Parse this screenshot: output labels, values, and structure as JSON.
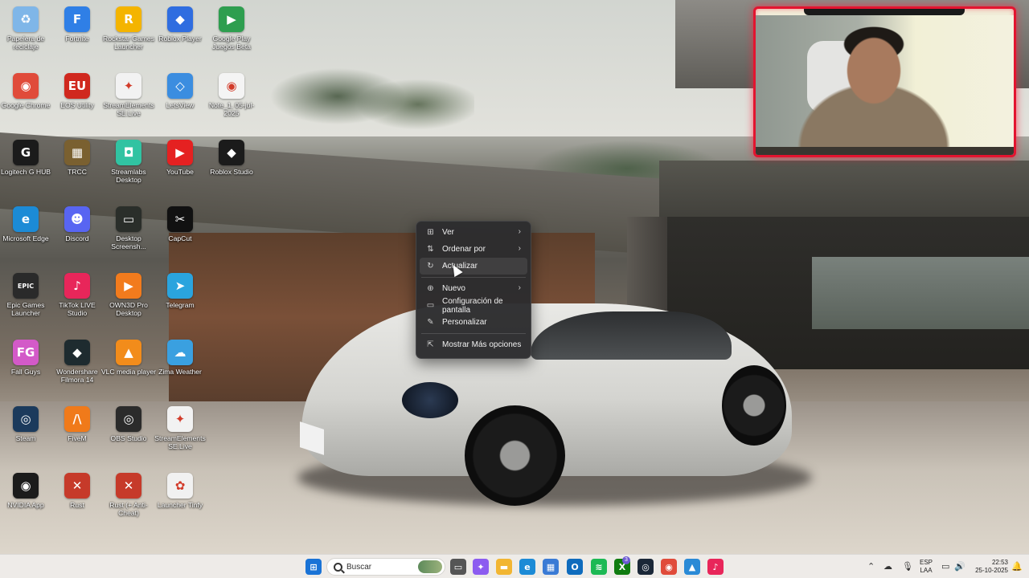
{
  "desktop": {
    "icons": [
      {
        "label": "Papelera de reciclaje",
        "icon": "recycle-bin-icon",
        "color": "#7fb6e8",
        "glyph": "♻"
      },
      {
        "label": "Fortnite",
        "icon": "fortnite-icon",
        "color": "#2f7fe6",
        "glyph": "F"
      },
      {
        "label": "Rockstar Games Launcher",
        "icon": "rockstar-icon",
        "color": "#f4b400",
        "glyph": "R"
      },
      {
        "label": "Roblox Player",
        "icon": "roblox-icon",
        "color": "#2f6de0",
        "glyph": "◆"
      },
      {
        "label": "Google Play Juegos Beta",
        "icon": "google-play-games-icon",
        "color": "#2e9e4f",
        "glyph": "▶"
      },
      {
        "label": "Google Chrome",
        "icon": "chrome-icon",
        "color": "#e04b3a",
        "glyph": "◉"
      },
      {
        "label": "EOS Utility",
        "icon": "eos-utility-icon",
        "color": "#d0281e",
        "glyph": "EU"
      },
      {
        "label": "StreamElements SE.Live",
        "icon": "streamelements-icon",
        "color": "#f2f2f2",
        "glyph": "✦"
      },
      {
        "label": "LetsView",
        "icon": "letsview-icon",
        "color": "#3b8de0",
        "glyph": "◇"
      },
      {
        "label": "Note_1, 05-jul-2025",
        "icon": "chrome-file-icon",
        "color": "#f4f4f4",
        "glyph": "◉"
      },
      {
        "label": "Logitech G HUB",
        "icon": "logitech-icon",
        "color": "#1b1b1b",
        "glyph": "G"
      },
      {
        "label": "TRCC",
        "icon": "trcc-icon",
        "color": "#7a6030",
        "glyph": "▦"
      },
      {
        "label": "Streamlabs Desktop",
        "icon": "streamlabs-icon",
        "color": "#31c3a2",
        "glyph": "◘"
      },
      {
        "label": "YouTube",
        "icon": "youtube-icon",
        "color": "#e52121",
        "glyph": "▶"
      },
      {
        "label": "Roblox Studio",
        "icon": "roblox-studio-icon",
        "color": "#1b1b1b",
        "glyph": "◆"
      },
      {
        "label": "Microsoft Edge",
        "icon": "edge-icon",
        "color": "#1c8bd6",
        "glyph": "e"
      },
      {
        "label": "Discord",
        "icon": "discord-icon",
        "color": "#5865f2",
        "glyph": "☻"
      },
      {
        "label": "Desktop Screensh...",
        "icon": "screenshot-file-icon",
        "color": "#2a2e2a",
        "glyph": "▭"
      },
      {
        "label": "CapCut",
        "icon": "capcut-icon",
        "color": "#111111",
        "glyph": "✂"
      },
      {
        "label": "Epic Games Launcher",
        "icon": "epic-games-icon",
        "color": "#2a2a2a",
        "glyph": "EPIC"
      },
      {
        "label": "TikTok LIVE Studio",
        "icon": "tiktok-live-icon",
        "color": "#e8265a",
        "glyph": "♪"
      },
      {
        "label": "OWN3D Pro Desktop",
        "icon": "own3d-icon",
        "color": "#f27b1d",
        "glyph": "▶"
      },
      {
        "label": "Telegram",
        "icon": "telegram-icon",
        "color": "#2aa4de",
        "glyph": "➤"
      },
      {
        "label": "Fall Guys",
        "icon": "fall-guys-icon",
        "color": "#d35ac8",
        "glyph": "FG"
      },
      {
        "label": "Wondershare Filmora 14",
        "icon": "filmora-icon",
        "color": "#1e2b2f",
        "glyph": "◆"
      },
      {
        "label": "VLC media player",
        "icon": "vlc-icon",
        "color": "#f28c1b",
        "glyph": "▲"
      },
      {
        "label": "Zima Weather",
        "icon": "zima-weather-icon",
        "color": "#3aa0e0",
        "glyph": "☁"
      },
      {
        "label": "Steam",
        "icon": "steam-icon",
        "color": "#1b3a5c",
        "glyph": "◎"
      },
      {
        "label": "FiveM",
        "icon": "fivem-icon",
        "color": "#f07a1a",
        "glyph": "/\\"
      },
      {
        "label": "OBS Studio",
        "icon": "obs-icon",
        "color": "#2b2b2b",
        "glyph": "◎"
      },
      {
        "label": "StreamElements SE.Live",
        "icon": "streamelements-live-icon",
        "color": "#f2f2f2",
        "glyph": "✦"
      },
      {
        "label": "NVIDIA App",
        "icon": "nvidia-icon",
        "color": "#1b1b1b",
        "glyph": "◉"
      },
      {
        "label": "Rust",
        "icon": "rust-icon",
        "color": "#c63a2a",
        "glyph": "✕"
      },
      {
        "label": "Rust (+ Anti-Cheat)",
        "icon": "rust-anticheat-icon",
        "color": "#c63a2a",
        "glyph": "✕"
      },
      {
        "label": "Launcher Tinfy",
        "icon": "launcher-tinfy-icon",
        "color": "#f1f1f1",
        "glyph": "✿"
      }
    ]
  },
  "context_menu": {
    "items": [
      {
        "label": "Ver",
        "icon": "grid-icon",
        "glyph": "⊞",
        "submenu": true
      },
      {
        "label": "Ordenar por",
        "icon": "sort-icon",
        "glyph": "⇅",
        "submenu": true
      },
      {
        "label": "Actualizar",
        "icon": "refresh-icon",
        "glyph": "↻",
        "submenu": false
      },
      {
        "label": "Nuevo",
        "icon": "new-plus-icon",
        "glyph": "⊕",
        "submenu": true
      },
      {
        "label": "Configuración de pantalla",
        "icon": "display-settings-icon",
        "glyph": "▭",
        "submenu": false
      },
      {
        "label": "Personalizar",
        "icon": "brush-icon",
        "glyph": "✎",
        "submenu": false
      },
      {
        "label": "Mostrar Más opciones",
        "icon": "more-options-icon",
        "glyph": "⇱",
        "submenu": false
      }
    ],
    "submenu_arrow": "›",
    "hovered": "Actualizar"
  },
  "taskbar": {
    "search_placeholder": "Buscar",
    "apps": [
      {
        "name": "start-icon",
        "color": "#1a73d6"
      },
      {
        "name": "task-view-icon",
        "color": "#555555"
      },
      {
        "name": "copilot-icon",
        "color": "#8c5cf0"
      },
      {
        "name": "file-explorer-icon",
        "color": "#f2b632"
      },
      {
        "name": "edge-icon",
        "color": "#1c8bd6"
      },
      {
        "name": "store-icon",
        "color": "#3a7bd5"
      },
      {
        "name": "outlook-icon",
        "color": "#0f6cbd"
      },
      {
        "name": "spotify-icon",
        "color": "#1db954"
      },
      {
        "name": "xbox-icon",
        "color": "#107c10"
      },
      {
        "name": "steam-icon",
        "color": "#1b2838"
      },
      {
        "name": "chrome-icon",
        "color": "#e04b3a"
      },
      {
        "name": "photos-icon",
        "color": "#2a8ad6"
      },
      {
        "name": "tiktok-icon",
        "color": "#e8265a"
      }
    ],
    "xbox_badge": "3",
    "tray": {
      "language_top": "ESP",
      "language_bottom": "LAA",
      "time": "22:53",
      "date": "25-10-2025"
    }
  }
}
